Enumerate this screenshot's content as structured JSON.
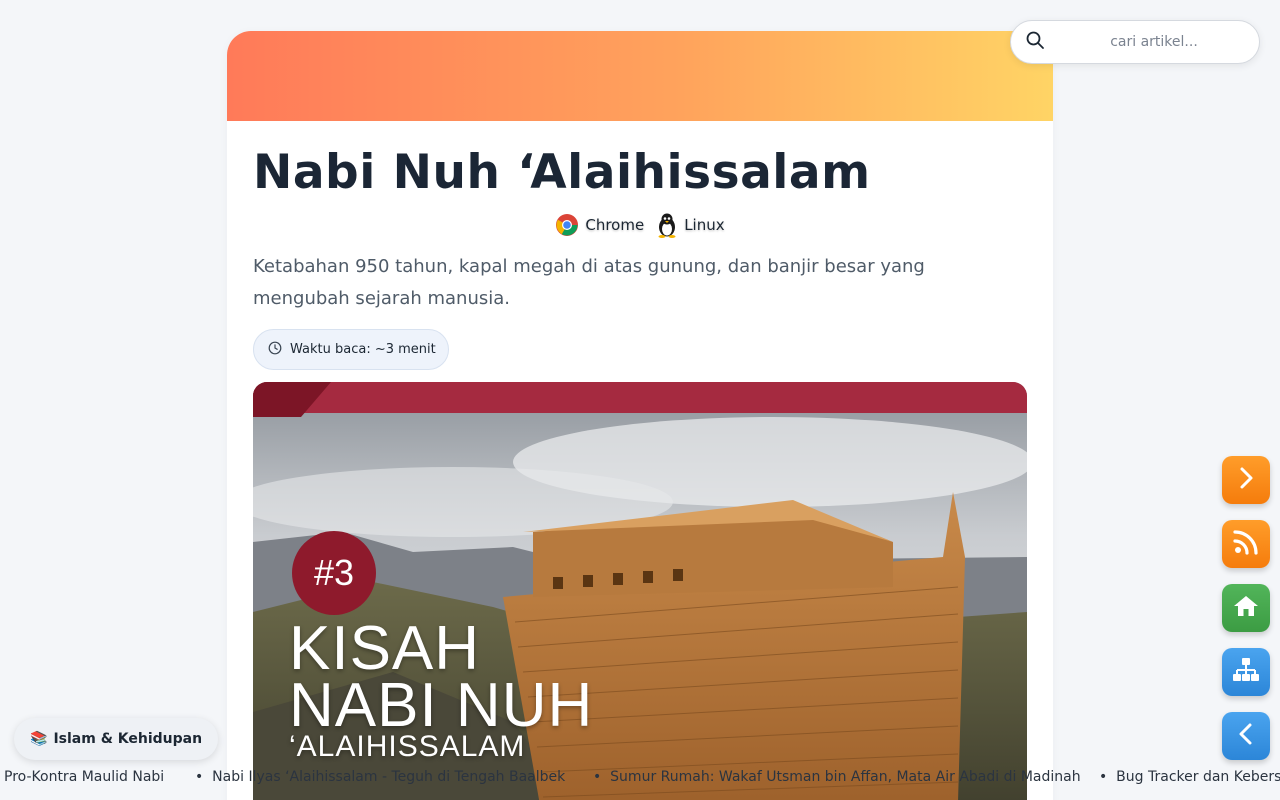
{
  "search": {
    "placeholder": "cari artikel..."
  },
  "article": {
    "title": "Nabi Nuh ‘Alaihissalam",
    "platforms": [
      {
        "label": "Chrome",
        "icon": "chrome-icon"
      },
      {
        "label": "Linux",
        "icon": "linux-tux-icon"
      }
    ],
    "lead": "Ketabahan 950 tahun, kapal megah di atas gunung, dan banjir besar yang mengubah sejarah manusia.",
    "reading_time": "Waktu baca: ~3 menit",
    "hero": {
      "badge": "#3",
      "line1": "KISAH",
      "line2": "NABI NUH",
      "line3": "‘ALAIHISSALAM"
    }
  },
  "category": {
    "icon": "📚",
    "label": "Islam & Kehidupan"
  },
  "floating_buttons": [
    {
      "name": "next-button",
      "icon": "chevron-right-icon"
    },
    {
      "name": "rss-button",
      "icon": "rss-icon"
    },
    {
      "name": "home-button",
      "icon": "home-icon"
    },
    {
      "name": "sitemap-button",
      "icon": "sitemap-icon"
    },
    {
      "name": "back-button",
      "icon": "chevron-left-icon"
    }
  ],
  "ticker": [
    "Pro-Kontra Maulid Nabi",
    "Nabi Ilyas ‘Alaihissalam - Teguh di Tengah Baalbek",
    "Sumur Rumah: Wakaf Utsman bin Affan, Mata Air Abadi di Madinah",
    "Bug Tracker dan Kebersamaan"
  ],
  "colors": {
    "banner_start": "#ff7a59",
    "banner_end": "#ffd465",
    "hero_band": "#a52a40",
    "badge": "#8e1a2c",
    "fab_orange": "#f57c0c",
    "fab_green": "#3c9c43",
    "fab_blue": "#2c86d8"
  }
}
